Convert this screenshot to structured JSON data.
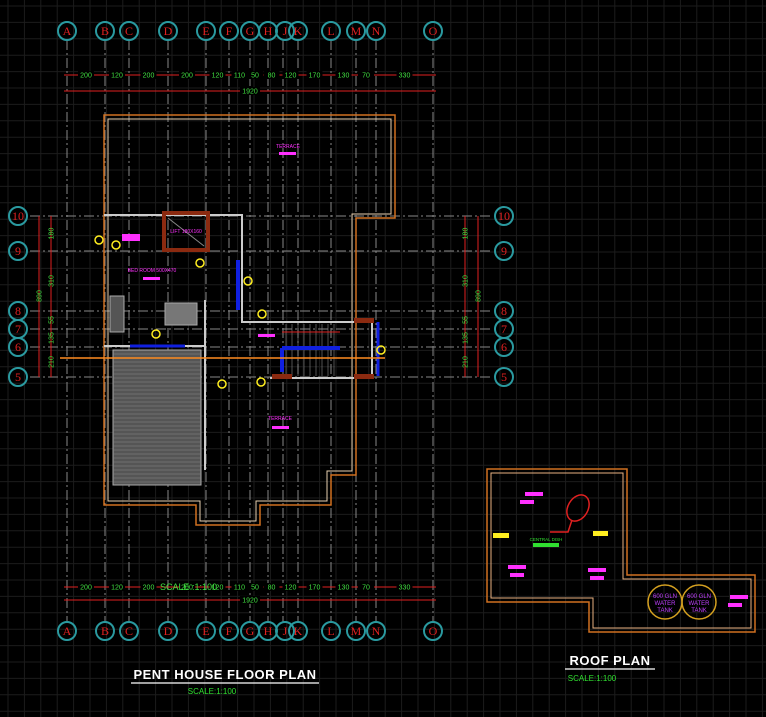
{
  "grid_columns": [
    "A",
    "B",
    "C",
    "D",
    "E",
    "F",
    "G",
    "H",
    "J",
    "K",
    "L",
    "M",
    "N",
    "O"
  ],
  "grid_rows": [
    "10",
    "9",
    "8",
    "7",
    "6",
    "5"
  ],
  "horizontal_dimensions": [
    "200",
    "120",
    "200",
    "200",
    "120",
    "110",
    "50",
    "80",
    "120",
    "170",
    "130",
    "70",
    "330"
  ],
  "horizontal_total": "1920",
  "vertical_dimensions": [
    "180",
    "310",
    "55",
    "135",
    "210"
  ],
  "vertical_total": "890",
  "rooms": {
    "terrace_top": "TERRACE",
    "lift": "LIFT 180X160",
    "bedroom": "BED ROOM 500X470",
    "terrace_bottom": "TERRACE"
  },
  "overlap_text": "SCALE :1:100",
  "floor_plan": {
    "title": "PENT HOUSE FLOOR PLAN",
    "scale": "SCALE:1:100"
  },
  "roof_plan": {
    "title": "ROOF PLAN",
    "scale": "SCALE:1:100",
    "dish_label": "CENTRAL DISH",
    "tank1": [
      "600 GLN",
      "WATER",
      "TANK"
    ],
    "tank2": [
      "600 GLN",
      "WATER",
      "TANK"
    ]
  },
  "colors": {
    "background": "#000000",
    "grid_bubble": "#2a9aa0",
    "dimension_line": "#e02020",
    "dimension_text": "#40e040",
    "wall": "#d07020",
    "label": "#ff30ff",
    "window": "#1020e0"
  }
}
